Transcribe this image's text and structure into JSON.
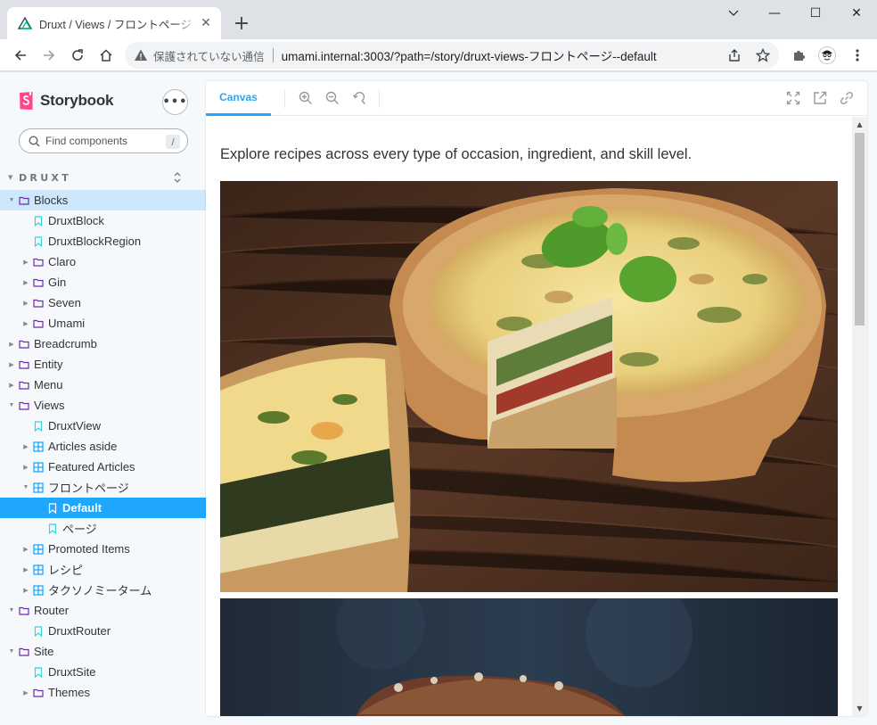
{
  "browser": {
    "tab_title": "Druxt / Views / フロントページ - Default",
    "tab_close": "✕",
    "new_tab": "+",
    "security_label": "保護されていない通信",
    "url": "umami.internal:3003/?path=/story/druxt-views-フロントページ--default",
    "window_controls": {
      "minimize": "—",
      "maximize": "☐",
      "close": "✕"
    }
  },
  "sidebar": {
    "brand_name": "Storybook",
    "menu_label": "•••",
    "search_placeholder": "Find components",
    "search_shortcut": "/",
    "group_title": "DRUXT",
    "items": [
      {
        "label": "Blocks",
        "type": "folder",
        "depth": 0,
        "expanded": true,
        "state": "active"
      },
      {
        "label": "DruxtBlock",
        "type": "story",
        "depth": 1
      },
      {
        "label": "DruxtBlockRegion",
        "type": "story",
        "depth": 1
      },
      {
        "label": "Claro",
        "type": "folder",
        "depth": 1,
        "expanded": false
      },
      {
        "label": "Gin",
        "type": "folder",
        "depth": 1,
        "expanded": false
      },
      {
        "label": "Seven",
        "type": "folder",
        "depth": 1,
        "expanded": false
      },
      {
        "label": "Umami",
        "type": "folder",
        "depth": 1,
        "expanded": false
      },
      {
        "label": "Breadcrumb",
        "type": "folder",
        "depth": 0,
        "expanded": false
      },
      {
        "label": "Entity",
        "type": "folder",
        "depth": 0,
        "expanded": false
      },
      {
        "label": "Menu",
        "type": "folder",
        "depth": 0,
        "expanded": false
      },
      {
        "label": "Views",
        "type": "folder",
        "depth": 0,
        "expanded": true
      },
      {
        "label": "DruxtView",
        "type": "story",
        "depth": 1
      },
      {
        "label": "Articles aside",
        "type": "component",
        "depth": 1,
        "expanded": false
      },
      {
        "label": "Featured Articles",
        "type": "component",
        "depth": 1,
        "expanded": false
      },
      {
        "label": "フロントページ",
        "type": "component",
        "depth": 1,
        "expanded": true
      },
      {
        "label": "Default",
        "type": "story",
        "depth": 2,
        "state": "selected"
      },
      {
        "label": "ページ",
        "type": "story",
        "depth": 2
      },
      {
        "label": "Promoted Items",
        "type": "component",
        "depth": 1,
        "expanded": false
      },
      {
        "label": "レシピ",
        "type": "component",
        "depth": 1,
        "expanded": false
      },
      {
        "label": "タクソノミーターム",
        "type": "component",
        "depth": 1,
        "expanded": false
      },
      {
        "label": "Router",
        "type": "folder",
        "depth": 0,
        "expanded": true
      },
      {
        "label": "DruxtRouter",
        "type": "story",
        "depth": 1
      },
      {
        "label": "Site",
        "type": "folder",
        "depth": 0,
        "expanded": true
      },
      {
        "label": "DruxtSite",
        "type": "story",
        "depth": 1
      },
      {
        "label": "Themes",
        "type": "folder",
        "depth": 1,
        "expanded": false
      }
    ]
  },
  "preview": {
    "canvas_tab": "Canvas",
    "lead_text": "Explore recipes across every type of occasion, ingredient, and skill level."
  },
  "colors": {
    "accent": "#1ea7fd",
    "active_row": "#cde7fd",
    "storybook_pink": "#ff4785",
    "folder_icon": "#6f2cac",
    "component_icon": "#1ea7fd",
    "story_icon": "#37d5d3"
  }
}
